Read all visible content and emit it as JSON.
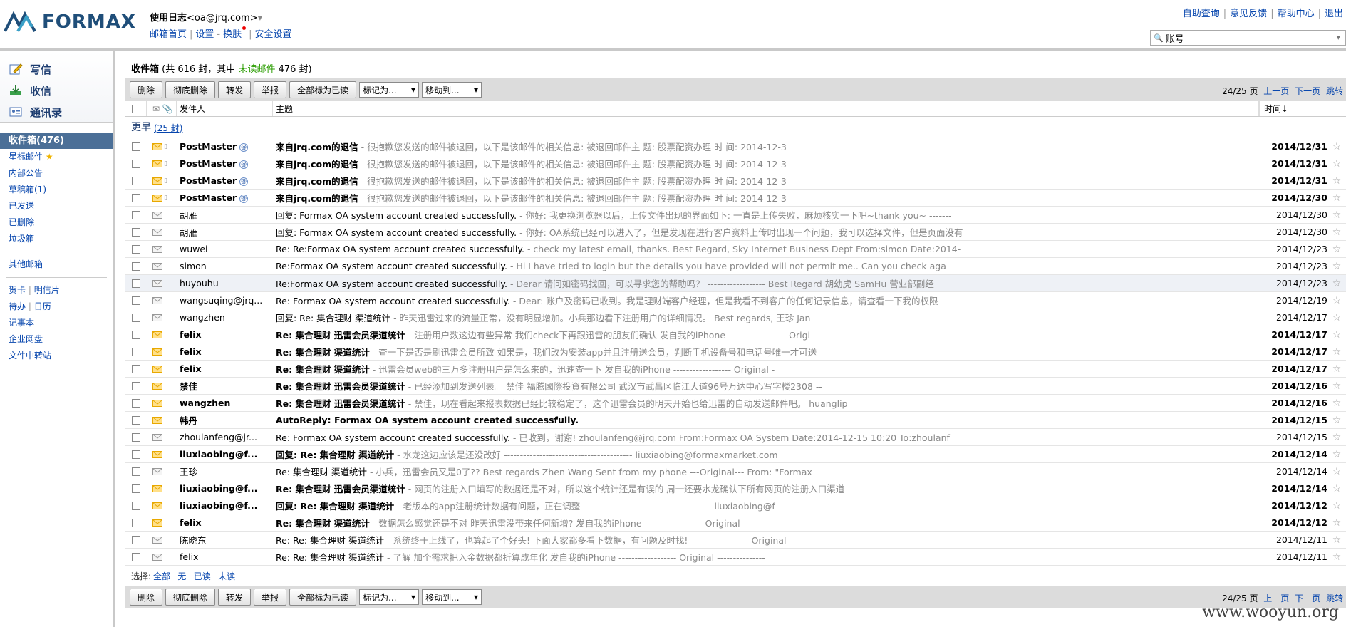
{
  "header": {
    "brand": "FORMAX",
    "account_name": "使用日志",
    "account_email": "<oa@jrq.com>",
    "nav": [
      "邮箱首页",
      "设置",
      "换肤",
      "安全设置"
    ],
    "top_links": [
      "自助查询",
      "意见反馈",
      "帮助中心",
      "退出"
    ],
    "search_value": "账号"
  },
  "sidebar": {
    "quick": [
      "写信",
      "收信",
      "通讯录"
    ],
    "folders_main": [
      "收件箱(476)",
      "星标邮件",
      "内部公告",
      "草稿箱(1)",
      "已发送",
      "已删除",
      "垃圾箱"
    ],
    "other_mail": "其他邮箱",
    "tools": {
      "row1": [
        "贺卡",
        "明信片"
      ],
      "row2": [
        "待办",
        "日历"
      ],
      "notes": "记事本",
      "disk": "企业网盘",
      "transfer": "文件中转站"
    }
  },
  "main": {
    "title": "收件箱",
    "summary_prefix": " (共 616 封，其中 ",
    "unread_label": "未读邮件",
    "summary_suffix": " 476 封)",
    "toolbar": {
      "buttons": [
        "删除",
        "彻底删除",
        "转发",
        "举报",
        "全部标为已读"
      ],
      "mark_as": "标记为...",
      "move_to": "移动到...",
      "page": "24/25 页",
      "prev": "上一页",
      "next": "下一页",
      "jump": "跳转"
    },
    "columns": {
      "from": "发件人",
      "subject": "主题",
      "time": "时间↓"
    },
    "group": {
      "label": "更早",
      "count": "(25 封)"
    },
    "select": {
      "label": "选择:",
      "all": "全部",
      "none": "无",
      "read": "已读",
      "unread": "未读"
    }
  },
  "emails": [
    {
      "from": "PostMaster",
      "subject": "来自jrq.com的退信",
      "preview": " - 很抱歉您发送的邮件被退回，以下是该邮件的相关信息:  被退回邮件主 题: 股票配资办理  时 间: 2014-12-3",
      "date": "2014/12/31",
      "unread": true,
      "pm": true
    },
    {
      "from": "PostMaster",
      "subject": "来自jrq.com的退信",
      "preview": " - 很抱歉您发送的邮件被退回，以下是该邮件的相关信息:  被退回邮件主 题: 股票配资办理  时 间: 2014-12-3",
      "date": "2014/12/31",
      "unread": true,
      "pm": true
    },
    {
      "from": "PostMaster",
      "subject": "来自jrq.com的退信",
      "preview": " - 很抱歉您发送的邮件被退回，以下是该邮件的相关信息:  被退回邮件主 题: 股票配资办理  时 间: 2014-12-3",
      "date": "2014/12/31",
      "unread": true,
      "pm": true
    },
    {
      "from": "PostMaster",
      "subject": "来自jrq.com的退信",
      "preview": " - 很抱歉您发送的邮件被退回，以下是该邮件的相关信息:  被退回邮件主 题: 股票配资办理  时 间: 2014-12-3",
      "date": "2014/12/30",
      "unread": true,
      "pm": true
    },
    {
      "from": "胡雁",
      "subject": "回复: Formax OA system account created successfully.",
      "preview": " - 你好: 我更换浏览器以后，上传文件出现的界面如下: 一直是上传失败，麻烦核实一下吧~thank you~   -------",
      "date": "2014/12/30",
      "unread": false
    },
    {
      "from": "胡雁",
      "subject": "回复: Formax OA system account created successfully.",
      "preview": " - 你好: OA系统已经可以进入了，但是发现在进行客户资料上传时出现一个问题，我可以选择文件，但是页面没有",
      "date": "2014/12/30",
      "unread": false
    },
    {
      "from": "wuwei",
      "subject": "Re: Re:Formax OA system account created successfully.",
      "preview": " -  check my latest email, thanks.   Best Regard, Sky Internet Business Dept    From:simon Date:2014-",
      "date": "2014/12/23",
      "unread": false
    },
    {
      "from": "simon",
      "subject": "Re:Formax OA system account created successfully.",
      "preview": " - Hi  I have tried to login but the details you have provided will not permit me..  Can you check aga",
      "date": "2014/12/23",
      "unread": false
    },
    {
      "from": "huyouhu",
      "subject": "Re:Formax OA system account created successfully.",
      "preview": " - Derar 请问如密码找回，可以寻求您的帮助吗？  ------------------ Best Regard 胡幼虎  SamHu 营业部副经",
      "date": "2014/12/23",
      "unread": false,
      "hl": true
    },
    {
      "from": "wangsuqing@jrq...",
      "subject": "Re: Formax OA system account created successfully.",
      "preview": " - Dear:   账户及密码已收到。我是理财端客户经理，但是我看不到客户的任何记录信息，请查看一下我的权限",
      "date": "2014/12/19",
      "unread": false
    },
    {
      "from": "wangzhen",
      "subject": "回复: Re: 集合理财 渠道统计",
      "preview": " -  昨天迅雷过来的流量正常，没有明显增加。小兵那边看下注册用户的详细情况。   Best regards,    王珍 Jan",
      "date": "2014/12/17",
      "unread": false
    },
    {
      "from": "felix",
      "subject": "Re: 集合理财 迅雷会员渠道统计",
      "preview": " - 注册用户数这边有些异常 我们check下再跟迅雷的朋友们确认  发自我的iPhone      ------------------ Origi",
      "date": "2014/12/17",
      "unread": true
    },
    {
      "from": "felix",
      "subject": "Re: 集合理财 渠道统计",
      "preview": " - 查一下是否是刷迅雷会员所致 如果是，我们改为安装app并且注册送会员，判断手机设备号和电话号唯一才可送",
      "date": "2014/12/17",
      "unread": true
    },
    {
      "from": "felix",
      "subject": "Re: 集合理财 渠道统计",
      "preview": " - 迅雷会员web的三万多注册用户是怎么来的，迅速查一下  发自我的iPhone      ------------------ Original -",
      "date": "2014/12/17",
      "unread": true
    },
    {
      "from": "禁佳",
      "subject": "Re: 集合理财 迅雷会员渠道统计",
      "preview": " - 已经添加到发送列表。   禁佳  福腾國際投資有限公司    武汉市武昌区临江大道96号万达中心写字楼2308    --",
      "date": "2014/12/16",
      "unread": true
    },
    {
      "from": "wangzhen",
      "subject": "Re: 集合理财 迅雷会员渠道统计",
      "preview": " - 禁佳，现在看起来报表数据已经比较稳定了，这个迅雷会员的明天开始也给迅雷的自动发送邮件吧。   huanglip",
      "date": "2014/12/16",
      "unread": true
    },
    {
      "from": "韩丹",
      "subject": "AutoReply: Formax OA system account created successfully.",
      "preview": "",
      "date": "2014/12/15",
      "unread": true
    },
    {
      "from": "zhoulanfeng@jr...",
      "subject": "Re: Formax OA system account created successfully.",
      "preview": " -  已收到，谢谢!       zhoulanfeng@jrq.com     From:Formax OA System Date:2014-12-15 10:20 To:zhoulanf",
      "date": "2014/12/15",
      "unread": false
    },
    {
      "from": "liuxiaobing@f...",
      "subject": "回复: Re: 集合理财 渠道统计",
      "preview": " - 水龙这边应该是还没改好     ---------------------------------------- liuxiaobing@formaxmarket.com",
      "date": "2014/12/14",
      "unread": true
    },
    {
      "from": "王珍",
      "subject": "Re: 集合理财 渠道统计",
      "preview": " - 小兵，迅雷会员又是0了??  Best regards  Zhen Wang  Sent from my phone   ---Original--- From: \"Formax",
      "date": "2014/12/14",
      "unread": false
    },
    {
      "from": "liuxiaobing@f...",
      "subject": "Re: 集合理财 迅雷会员渠道统计",
      "preview": " - 网页的注册入口填写的数据还是不对，所以这个统计还是有误的  周一还要水龙确认下所有网页的注册入口渠道",
      "date": "2014/12/14",
      "unread": true
    },
    {
      "from": "liuxiaobing@f...",
      "subject": "回复: Re: 集合理财 渠道统计",
      "preview": " - 老版本的app注册统计数据有问题，正在调整    ---------------------------------------- liuxiaobing@f",
      "date": "2014/12/12",
      "unread": true
    },
    {
      "from": "felix",
      "subject": "Re: 集合理财 渠道统计",
      "preview": " - 数据怎么感觉还是不对  昨天迅雷没带来任何新增?   发自我的iPhone      ------------------ Original ----",
      "date": "2014/12/12",
      "unread": true
    },
    {
      "from": "陈晓东",
      "subject": "Re:  Re: 集合理财 渠道统计",
      "preview": " - 系统终于上线了，也算起了个好头! 下面大家都多看下数据，有问题及时找!    ------------------ Original",
      "date": "2014/12/11",
      "unread": false
    },
    {
      "from": "felix",
      "subject": "Re:  Re: 集合理财 渠道统计",
      "preview": " - 了解 加个需求把入金数据都折算成年化  发自我的iPhone      ------------------ Original ---------------",
      "date": "2014/12/11",
      "unread": false
    }
  ],
  "watermark": "www.wooyun.org",
  "colors": {
    "accent": "#4b6f97",
    "unread_green": "#2a9d00",
    "toolbar_bg": "#dcdcdc",
    "envelope": "#e8a800"
  }
}
